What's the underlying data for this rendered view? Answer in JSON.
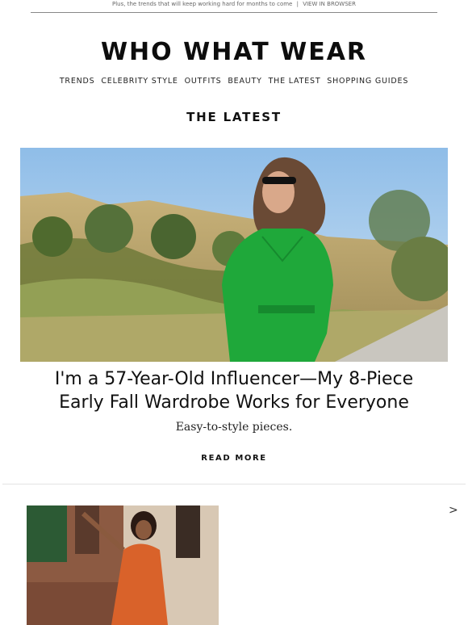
{
  "preheader": {
    "text": "Plus, the trends that will keep working hard for months to come",
    "separator": "|",
    "view_in_browser": "VIEW IN BROWSER"
  },
  "brand": {
    "logo": "WHO WHAT WEAR"
  },
  "nav": {
    "items": [
      {
        "label": "TRENDS"
      },
      {
        "label": "CELEBRITY STYLE"
      },
      {
        "label": "OUTFITS"
      },
      {
        "label": "BEAUTY"
      },
      {
        "label": "THE LATEST"
      },
      {
        "label": "SHOPPING GUIDES"
      }
    ]
  },
  "section": {
    "title": "THE LATEST"
  },
  "feature": {
    "headline_line1": "I'm a 57-Year-Old Influencer—My 8-Piece",
    "headline_line2": "Early Fall Wardrobe Works for Everyone",
    "dek": "Easy-to-style pieces.",
    "cta": "READ MORE"
  },
  "carousel": {
    "next_glyph": ">"
  },
  "colors": {
    "dress_green": "#1fa83a",
    "dress_orange": "#d9622a",
    "sky": "#a8cdee"
  }
}
